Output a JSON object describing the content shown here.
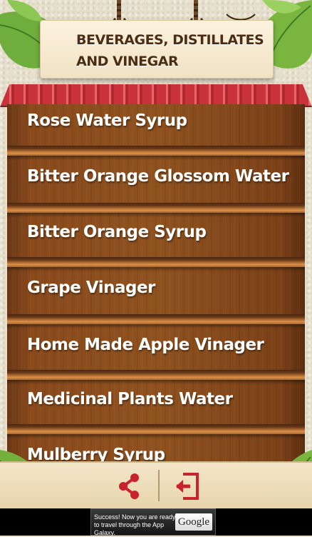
{
  "header": {
    "title_line1": "BEVERAGES, DISTILLATES",
    "title_line2": "AND VINEGAR"
  },
  "shelf": {
    "items": [
      {
        "label": "Rose Water Syrup"
      },
      {
        "label": "Bitter Orange Glossom Water"
      },
      {
        "label": "Bitter Orange Syrup"
      },
      {
        "label": "Grape Vinager"
      },
      {
        "label": "Home Made Apple Vinager"
      },
      {
        "label": "Medicinal Plants Water"
      },
      {
        "label": "Mulberry Syrup"
      }
    ]
  },
  "toolbar": {
    "share_icon": "share-icon",
    "exit_icon": "exit-icon",
    "accent_color": "#c8232c"
  },
  "ad": {
    "text": "Success! Now you are ready to travel through the App Galaxy.",
    "logo": "Google"
  },
  "colors": {
    "wood": "#8a4a1c",
    "awning": "#c8323a",
    "sign": "#f6ead2",
    "title_text": "#4b2d14"
  }
}
